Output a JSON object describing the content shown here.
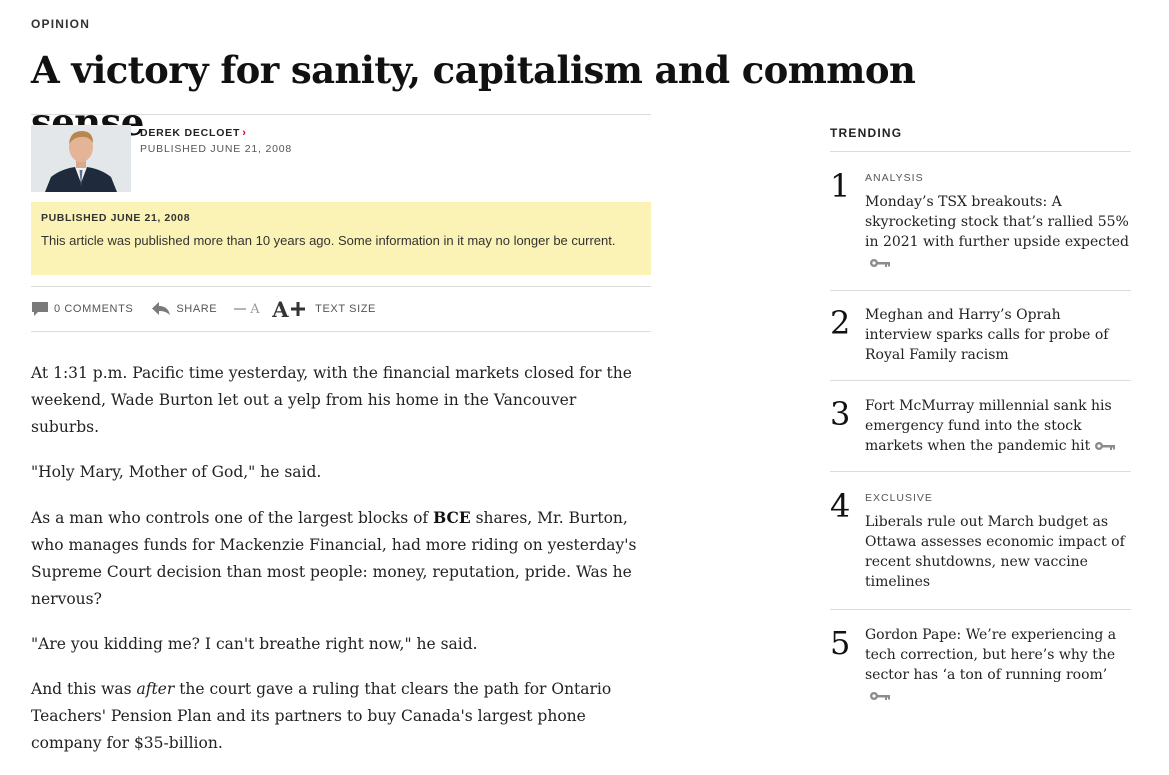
{
  "section": "OPINION",
  "headline": "A victory for sanity, capitalism and common sense",
  "byline": {
    "author": "DEREK DECLOET",
    "chevron": "›",
    "published": "PUBLISHED JUNE 21, 2008"
  },
  "notice": {
    "title": "PUBLISHED JUNE 21, 2008",
    "body": "This article was published more than 10 years ago. Some information in it may no longer be current."
  },
  "toolbar": {
    "comments": "0 COMMENTS",
    "share": "SHARE",
    "decrease_glyph": "A",
    "increase_glyph": "A",
    "text_size": "TEXT SIZE"
  },
  "article": {
    "p1": "At 1:31 p.m. Pacific time yesterday, with the financial markets closed for the weekend, Wade Burton let out a yelp from his home in the Vancouver suburbs.",
    "p2": "\"Holy Mary, Mother of God,\" he said.",
    "p3_before": "As a man who controls one of the largest blocks of ",
    "p3_bold": "BCE",
    "p3_after": " shares, Mr. Burton, who manages funds for Mackenzie Financial, had more riding on yesterday's Supreme Court decision than most people: money, reputation, pride. Was he nervous?",
    "p4": "\"Are you kidding me? I can't breathe right now,\" he said.",
    "p5_before": "And this was ",
    "p5_italic": "after",
    "p5_after": " the court gave a ruling that clears the path for Ontario Teachers' Pension Plan and its partners to buy Canada's largest phone company for $35-billion."
  },
  "trending": {
    "label": "TRENDING",
    "items": [
      {
        "num": "1",
        "kicker": "ANALYSIS",
        "title": "Monday’s TSX breakouts: A skyrocketing stock that’s rallied 55% in 2021 with further upside expected",
        "premium": true
      },
      {
        "num": "2",
        "kicker": "",
        "title": "Meghan and Harry’s Oprah interview sparks calls for probe of Royal Family racism",
        "premium": false
      },
      {
        "num": "3",
        "kicker": "",
        "title": "Fort McMurray millennial sank his emergency fund into the stock markets when the pandemic hit",
        "premium": true
      },
      {
        "num": "4",
        "kicker": "EXCLUSIVE",
        "title": "Liberals rule out March budget as Ottawa assesses economic impact of recent shutdowns, new vaccine timelines",
        "premium": false
      },
      {
        "num": "5",
        "kicker": "",
        "title": "Gordon Pape: We’re experiencing a tech correction, but here’s why the sector has ‘a ton of running room’",
        "premium": true
      }
    ]
  },
  "icons": [
    "comment-icon",
    "share-icon",
    "plus-icon",
    "minus-icon",
    "key-icon"
  ],
  "colors": {
    "notice_bg": "#fbf3b5",
    "accent_red": "#d0021b",
    "divider": "#dcdcdc"
  }
}
